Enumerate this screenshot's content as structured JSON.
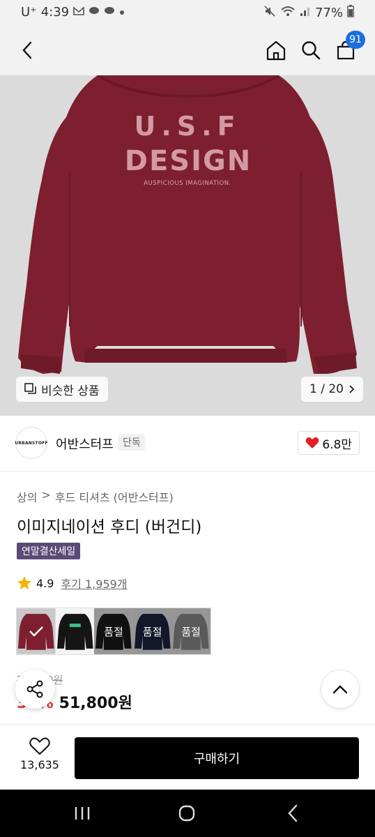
{
  "status": {
    "carrier": "U⁺",
    "time": "4:39",
    "battery": "77%"
  },
  "nav": {
    "cart_count": "91"
  },
  "hero": {
    "print_line1": "U.S.F",
    "print_line2": "DESIGN",
    "print_line3": "AUSPICIOUS IMAGINATION.",
    "similar_label": "비슷한 상품",
    "pager": "1 / 20"
  },
  "brand": {
    "logo_text": "URBANSTOFF",
    "name": "어반스터프",
    "exclusive_tag": "단독",
    "likes": "6.8만"
  },
  "breadcrumb": {
    "category": "상의",
    "separator": ">",
    "subcategory": "후드 티셔츠 (어반스터프)"
  },
  "product": {
    "title": "이미지네이션 후디 (버건디)",
    "sale_badge": "연말결산세일",
    "rating": "4.9",
    "reviews": "후기 1,959개"
  },
  "swatches": [
    {
      "color": "#7a1f2e",
      "state": "selected",
      "label": ""
    },
    {
      "color": "#151515",
      "state": "available",
      "label": ""
    },
    {
      "color": "#1a1a1a",
      "state": "soldout",
      "label": "품절"
    },
    {
      "color": "#1c2440",
      "state": "soldout",
      "label": "품절"
    },
    {
      "color": "#8a8a8a",
      "state": "soldout",
      "label": "품절"
    }
  ],
  "price": {
    "original": "74,000원",
    "discount": "30%",
    "current": "51,800원"
  },
  "bottom": {
    "wish_count": "13,635",
    "buy_label": "구매하기"
  },
  "colors": {
    "hoodie": "#7d1f2f",
    "badge_blue": "#1b6fde",
    "sale_purple": "#5a4a78",
    "heart_red": "#e02020",
    "star_yellow": "#f5b400"
  }
}
